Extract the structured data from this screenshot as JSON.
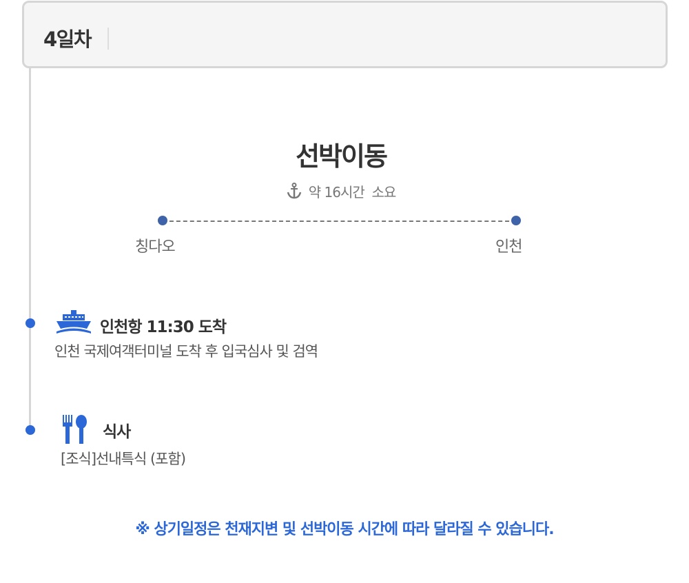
{
  "header": {
    "day": "4일차"
  },
  "transfer": {
    "title": "선박이동",
    "icon": "anchor-icon",
    "duration": "약 16시간  소요",
    "from": "칭다오",
    "to": "인천"
  },
  "events": [
    {
      "icon": "ship-icon",
      "title": "인천항 11:30 도착",
      "desc": "인천 국제여객터미널 도착 후 입국심사 및 검역"
    },
    {
      "icon": "fork-spoon-icon",
      "title": "식사",
      "desc": "[조식]선내특식 (포함)"
    }
  ],
  "note": "※ 상기일정은 천재지변 및 선박이동 시간에 따라 달라질 수 있습니다.",
  "colors": {
    "accent": "#2b67d6",
    "route": "#3f63a8"
  }
}
